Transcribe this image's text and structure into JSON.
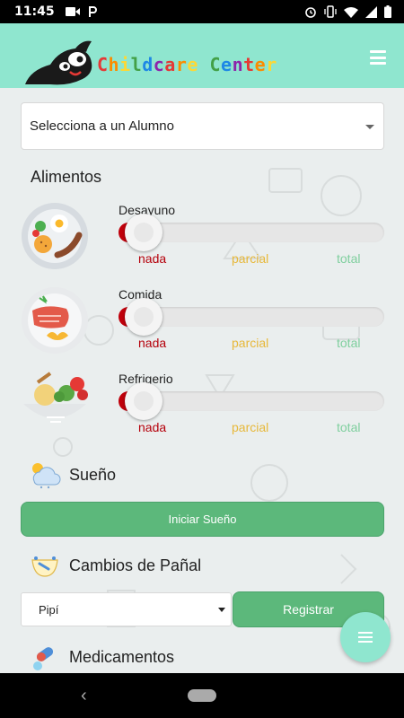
{
  "status_bar": {
    "time": "11:45",
    "left_icons": [
      "video-icon",
      "parking-p-icon"
    ],
    "right_icons": [
      "alarm-icon",
      "vibrate-icon",
      "wifi-icon",
      "signal-icon",
      "battery-icon"
    ]
  },
  "app_bar": {
    "logo_text": "Childcare Center",
    "logo_letter_colors": [
      "#e53935",
      "#fb8c00",
      "#fdd835",
      "#43a047",
      "#1e88e5",
      "#8e24aa",
      "#e53935",
      "#fb8c00",
      "#fdd835",
      "#43a047",
      "#1e88e5",
      "#8e24aa",
      "#e53935",
      "#fb8c00",
      "#fdd835",
      "#43a047"
    ],
    "background": "#8fe6cf"
  },
  "student_select": {
    "value": "Selecciona a un Alumno"
  },
  "alimentos": {
    "title": "Alimentos",
    "items": [
      {
        "label": "Desayuno",
        "value": 0
      },
      {
        "label": "Comida",
        "value": 0
      },
      {
        "label": "Refrigerio",
        "value": 0
      }
    ],
    "levels": {
      "nada": "nada",
      "parcial": "parcial",
      "total": "total"
    },
    "colors": {
      "fill": "#c0000b",
      "nada": "#b5000b",
      "parcial": "#e7b83a",
      "total": "#7fcf9e"
    }
  },
  "sueno": {
    "title": "Sueño",
    "button": "Iniciar Sueño"
  },
  "panal": {
    "title": "Cambios de Pañal",
    "select_value": "Pipí",
    "button": "Registrar"
  },
  "medicamentos": {
    "title": "Medicamentos"
  },
  "accent_green": "#5cb87b"
}
